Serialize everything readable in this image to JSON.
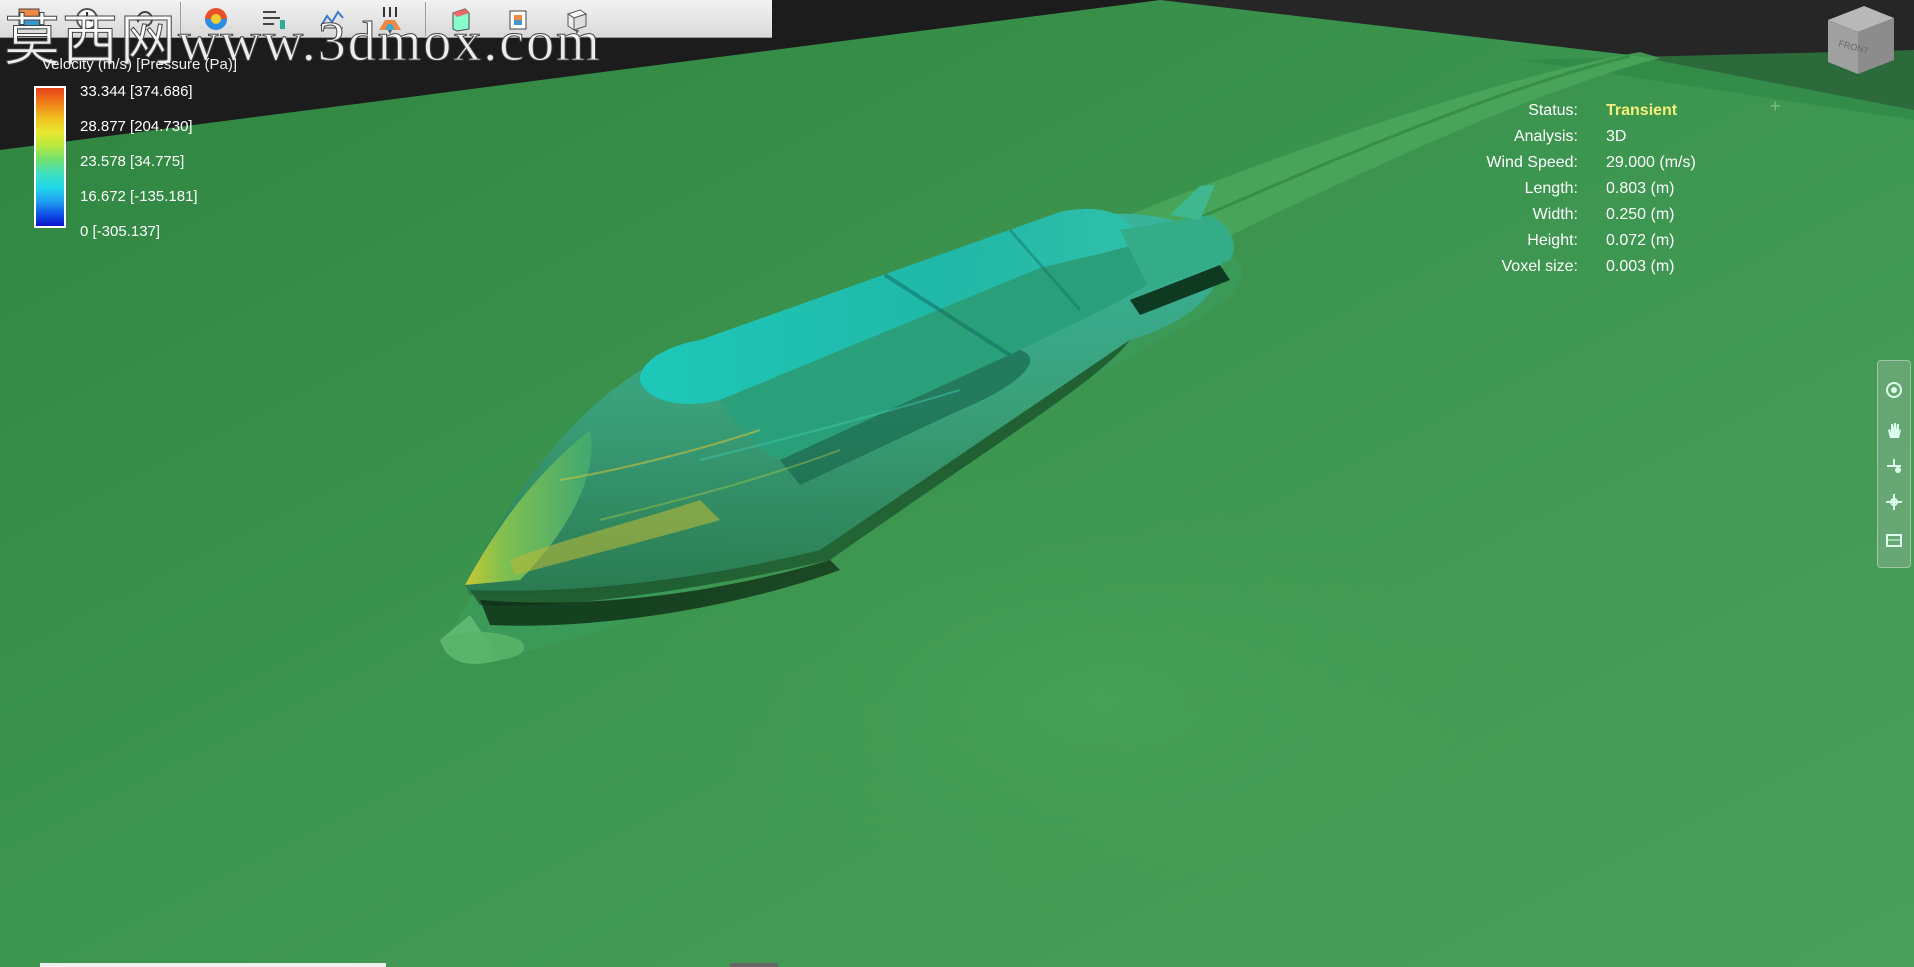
{
  "watermark": "莫西网www.3dmox.com",
  "toolbar": {
    "tools": [
      {
        "icon": "result-palette-icon"
      },
      {
        "icon": "clock-icon"
      },
      {
        "icon": "rotate-icon"
      },
      {
        "icon": "color-sphere-icon"
      },
      {
        "icon": "sequence-icon"
      },
      {
        "icon": "chart-icon"
      },
      {
        "icon": "wind-direction-icon"
      },
      {
        "icon": "building-icon"
      },
      {
        "icon": "building-multi-icon"
      },
      {
        "icon": "cube-icon"
      }
    ]
  },
  "legend": {
    "title": "Velocity (m/s) [Pressure (Pa)]",
    "labels": [
      "33.344 [374.686]",
      "28.877 [204.730]",
      "23.578 [34.775]",
      "16.672 [-135.181]",
      "0 [-305.137]"
    ]
  },
  "status": {
    "rows": [
      {
        "key": "Status:",
        "value": "Transient"
      },
      {
        "key": "Analysis:",
        "value": "3D"
      },
      {
        "key": "Wind Speed:",
        "value": "29.000 (m/s)"
      },
      {
        "key": "Length:",
        "value": "0.803 (m)"
      },
      {
        "key": "Width:",
        "value": "0.250 (m)"
      },
      {
        "key": "Height:",
        "value": "0.072 (m)"
      },
      {
        "key": "Voxel size:",
        "value": "0.003 (m)"
      }
    ]
  },
  "viewcube": {
    "face_label": "FRONT"
  },
  "nav": {
    "items": [
      "orbit-icon",
      "pan-icon",
      "zoom-icon",
      "look-icon",
      "fit-icon"
    ]
  },
  "colors": {
    "ground": "#3f9650",
    "status_highlight": "#f6f07a",
    "toolbar_bg": "#e6e6e6"
  }
}
